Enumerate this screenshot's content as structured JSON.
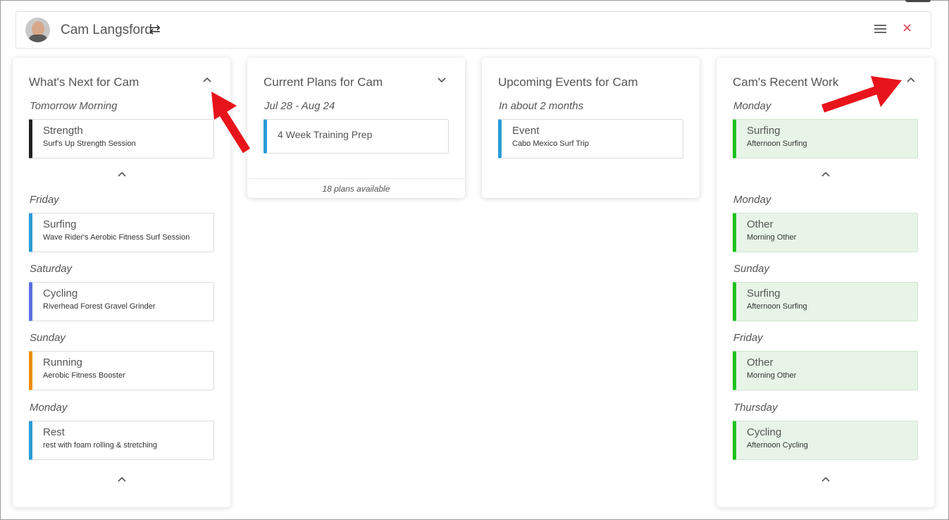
{
  "header": {
    "athlete_name": "Cam Langsford",
    "switch_icon": "⇄",
    "menu_icon": "hamburger-icon",
    "close_icon": "×"
  },
  "whats_next": {
    "title": "What's Next for Cam",
    "groups": [
      {
        "day": "Tomorrow Morning",
        "items": [
          {
            "type": "Strength",
            "name": "Surf's Up Strength Session",
            "color": "#222222"
          }
        ]
      },
      {
        "day": "Friday",
        "items": [
          {
            "type": "Surfing",
            "name": "Wave Rider's Aerobic Fitness Surf Session",
            "color": "#2b9bd8"
          }
        ]
      },
      {
        "day": "Saturday",
        "items": [
          {
            "type": "Cycling",
            "name": "Riverhead Forest Gravel Grinder",
            "color": "#5b6ee1"
          }
        ]
      },
      {
        "day": "Sunday",
        "items": [
          {
            "type": "Running",
            "name": "Aerobic Fitness Booster",
            "color": "#f08c00"
          }
        ]
      },
      {
        "day": "Monday",
        "items": [
          {
            "type": "Rest",
            "name": "rest with foam rolling & stretching",
            "color": "#2b9bd8"
          }
        ]
      }
    ]
  },
  "current_plans": {
    "title": "Current Plans for Cam",
    "date_range": "Jul 28 - Aug 24",
    "plan_name": "4 Week Training Prep",
    "footer": "18 plans available"
  },
  "upcoming_events": {
    "title": "Upcoming Events for Cam",
    "when": "In about 2 months",
    "event_type": "Event",
    "event_name": "Cabo Mexico Surf Trip"
  },
  "recent_work": {
    "title": "Cam's Recent Work",
    "groups": [
      {
        "day": "Monday",
        "items": [
          {
            "type": "Surfing",
            "name": "Afternoon Surfing"
          }
        ]
      },
      {
        "day": "Monday",
        "items": [
          {
            "type": "Other",
            "name": "Morning Other"
          }
        ]
      },
      {
        "day": "Sunday",
        "items": [
          {
            "type": "Surfing",
            "name": "Afternoon Surfing"
          }
        ]
      },
      {
        "day": "Friday",
        "items": [
          {
            "type": "Other",
            "name": "Morning Other"
          }
        ]
      },
      {
        "day": "Thursday",
        "items": [
          {
            "type": "Cycling",
            "name": "Afternoon Cycling"
          }
        ]
      }
    ]
  },
  "colors": {
    "done_green": "#1ec21e",
    "done_bg": "#e8f4e8",
    "accent_blue": "#2b9bd8",
    "arrow_red": "#e8141c",
    "close_red": "#d9334a"
  }
}
